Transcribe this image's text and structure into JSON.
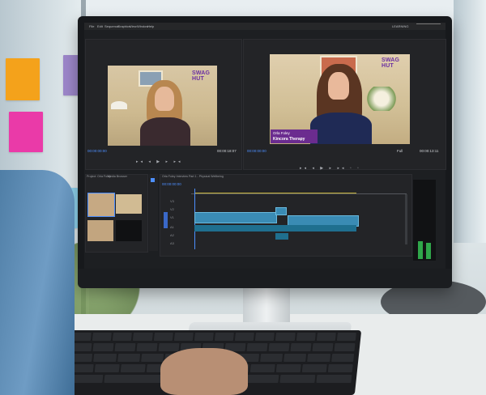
{
  "app": {
    "menu": [
      "File",
      "Edit",
      "Sequence",
      "Graphics",
      "View",
      "Window",
      "Help"
    ],
    "workspace_label": "LEARNING"
  },
  "source_monitor": {
    "logo": "SWAG HUT",
    "timecode_left": "00:00:00:00",
    "timecode_right": "00:00:18:07"
  },
  "program_monitor": {
    "logo": "SWAG HUT",
    "lower_third_name": "Orla Foley",
    "lower_third_company": "Kincora Therapy",
    "timecode_left": "00:00:00:00",
    "fit_label": "Full",
    "timecode_right": "00:00:13:11"
  },
  "project_panel": {
    "tab": "Project: Orla Foley",
    "media_tab": "Media Browser"
  },
  "timeline": {
    "sequence_tab": "Orla Foley Interview Part 1 - Physical Wellbeing",
    "timecode": "00:00:00:00",
    "tracks": [
      "V3",
      "V2",
      "V1",
      "A1",
      "A2",
      "A3"
    ]
  },
  "colors": {
    "playhead_blue": "#4d8fff",
    "clip_blue": "#3a8bb4",
    "brand_purple": "#6b2c8f"
  }
}
